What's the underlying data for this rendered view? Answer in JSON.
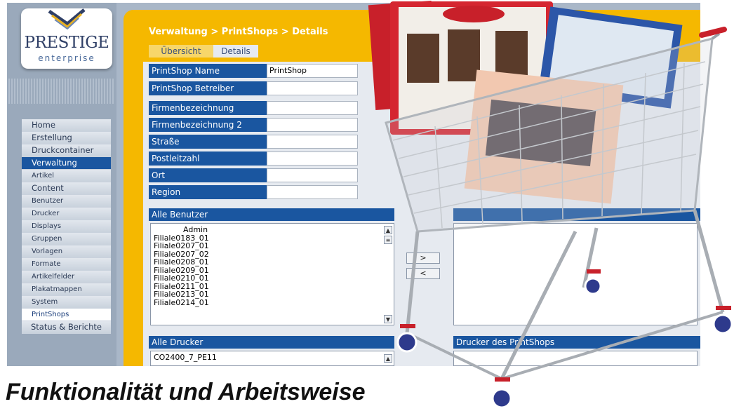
{
  "logo": {
    "name": "PRESTIGE",
    "sub": "enterprise"
  },
  "nav": [
    {
      "label": "Home",
      "style": ""
    },
    {
      "label": "Erstellung",
      "style": ""
    },
    {
      "label": "Druckcontainer",
      "style": ""
    },
    {
      "label": "Verwaltung",
      "style": "active"
    },
    {
      "label": "Artikel",
      "style": "small"
    },
    {
      "label": "Content",
      "style": ""
    },
    {
      "label": "Benutzer",
      "style": "small"
    },
    {
      "label": "Drucker",
      "style": "small"
    },
    {
      "label": "Displays",
      "style": "small"
    },
    {
      "label": "Gruppen",
      "style": "small"
    },
    {
      "label": "Vorlagen",
      "style": "small"
    },
    {
      "label": "Formate",
      "style": "small"
    },
    {
      "label": "Artikelfelder",
      "style": "small"
    },
    {
      "label": "Plakatmappen",
      "style": "small"
    },
    {
      "label": "System",
      "style": "small"
    },
    {
      "label": "PrintShops",
      "style": "active2"
    },
    {
      "label": "Status & Berichte",
      "style": "last"
    }
  ],
  "breadcrumb": "Verwaltung > PrintShops > Details",
  "tabs": [
    "Übersicht",
    "Details"
  ],
  "form": {
    "name_label": "PrintShop Name",
    "name_value": "PrintShop",
    "operator_label": "PrintShop Betreiber",
    "operator_value": "",
    "company_label": "Firmenbezeichnung",
    "company2_label": "Firmenbezeichnung 2",
    "street_label": "Straße",
    "zip_label": "Postleitzahl",
    "city_label": "Ort",
    "region_label": "Region"
  },
  "users_panel": {
    "title": "Alle Benutzer",
    "items": [
      "Admin",
      "Filiale0183_01",
      "Filiale0207_01",
      "Filiale0207_02",
      "Filiale0208_01",
      "Filiale0209_01",
      "Filiale0210_01",
      "Filiale0211_01",
      "Filiale0213_01",
      "Filiale0214_01"
    ]
  },
  "buttons": {
    "add": ">",
    "remove": "<"
  },
  "printers_panel": {
    "title": "Alle Drucker",
    "items": [
      "CO2400_7_PE11"
    ]
  },
  "shop_printers_panel": {
    "title": "Drucker des PrintShops"
  },
  "caption": "Funktionalität und Arbeitsweise",
  "colors": {
    "accent": "#1a56a0",
    "frame": "#f5b800",
    "background": "#a9b7c8"
  }
}
